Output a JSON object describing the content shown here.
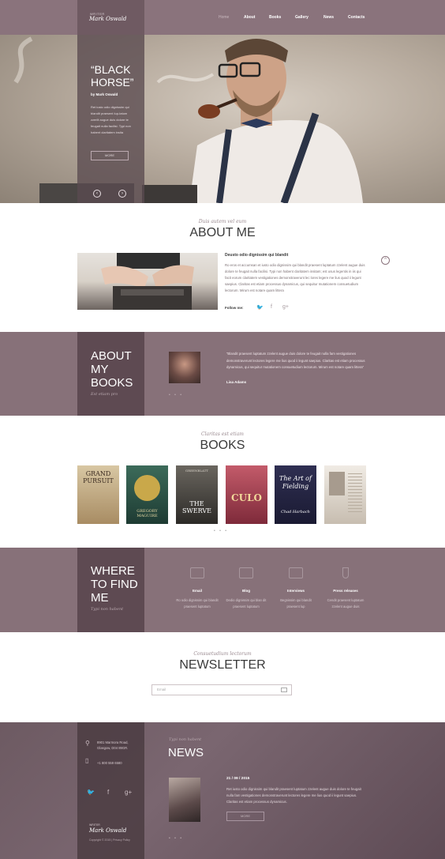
{
  "header": {
    "brand_sub": "WRITER",
    "brand_name": "Mark Oswald",
    "nav": [
      "Home",
      "About",
      "Books",
      "Gallery",
      "News",
      "Contacts"
    ]
  },
  "hero": {
    "title_line1": "“BLACK",
    "title_line2": "HORSE”",
    "by": "by Mark Oswald",
    "description": "Ret iusto odio dignissim qui blandit praesent lup-tatum zzerilt augue duis dolore te feugait nulla facilisi. Typi non habent claritatem insita",
    "more_label": "MORE",
    "prev": "‹",
    "next": "›"
  },
  "about": {
    "script": "Duis autem vel eum",
    "title": "ABOUT ME",
    "heading": "Deusto odio dignissim qui blandit",
    "text": "Ro eros et accumsan et iusto odio dignissim qui blandit praesent luptatum zzelent augue duis dolore te feugait nulla facilisi. Typi non habent claritatem insitam; est usus legentis in iis qui facit eorum claritatem vestigationes demonstraverunt lec lores legere me lius quod ii legunt saepius. Claritas est etiam processus dynamicus, qui sequitur mutationem consuetudium lectorum. Mirum est notare quam littera",
    "follow_label": "Follow me:",
    "up": "^"
  },
  "about_books": {
    "title_lines": [
      "ABOUT",
      "MY",
      "BOOKS"
    ],
    "script": "Est etiam pro",
    "quote": "“Blandit praesent luptatum zzelent augue duis dolore te feugait nulla fam vestigationes demonstraverunt lectores legere me lius quod ii legunt saepius. Claritas est etiam processus dynamicus, qui sequitur mutationem consuetudium lectorum. Mirum est notare quam littera”",
    "author": "Lisa Adams",
    "dots": "• • •"
  },
  "books": {
    "script": "Claritas est etiam",
    "title": "BOOKS",
    "items": [
      {
        "title": "GRAND PURSUIT",
        "sub": "",
        "colors": [
          "#d8c7a3",
          "#a88c63"
        ]
      },
      {
        "title": "GREGORY MAGUIRE",
        "sub": "",
        "colors": [
          "#3c6b5a",
          "#1e3b33"
        ]
      },
      {
        "title": "THE SWERVE",
        "sub": "GREENBLATT",
        "colors": [
          "#6a665f",
          "#2c2a27"
        ]
      },
      {
        "title": "CULO",
        "sub": "",
        "colors": [
          "#c35b6a",
          "#7e2a3a"
        ]
      },
      {
        "title": "The Art of Fielding",
        "sub": "Chad Harbach",
        "colors": [
          "#2f2f52",
          "#1a1a32"
        ]
      },
      {
        "title": "",
        "sub": "",
        "colors": [
          "#f0ebe4",
          "#c7bdb0"
        ]
      }
    ],
    "dots": "• • •"
  },
  "where": {
    "title_lines": [
      "WHERE",
      "TO FIND",
      "ME"
    ],
    "script": "Typi non habent",
    "items": [
      {
        "title": "Email",
        "desc": "Ro odio dignissim qui blandit praesent luptatum"
      },
      {
        "title": "Blog",
        "desc": "Dedio dignissim qui blan dit praesent luptatum"
      },
      {
        "title": "Interviews",
        "desc": "Begnissim qui blandit praesent lup"
      },
      {
        "title": "Press releases",
        "desc": "Cendit praesent luptatum zzelent augue duis"
      }
    ]
  },
  "newsletter": {
    "script": "Consuetudium lectorum",
    "title": "NEWSLETTER",
    "placeholder": "Email"
  },
  "footer": {
    "address": "8901 Marmora Road, Glasgow, D04 89GR.",
    "phone": "+1 800 559 6580",
    "brand_sub": "WRITER",
    "brand_name": "Mark Oswald",
    "copyright": "Copyright © 2015 | Privacy Policy",
    "news_script": "Typi non habent",
    "news_title": "NEWS",
    "news_date": "21 / 09 / 2015",
    "news_text": "Ret iusto odio dignissim qui blandit praesent luptatum zzelent augue duis dolore te feugait nulla fam vestigationes demonstraverunt lectores legere me lius quod ii legunt saepius. Claritas est etiam processus dynamicus.",
    "news_more": "MORE",
    "dots": "• • •"
  }
}
